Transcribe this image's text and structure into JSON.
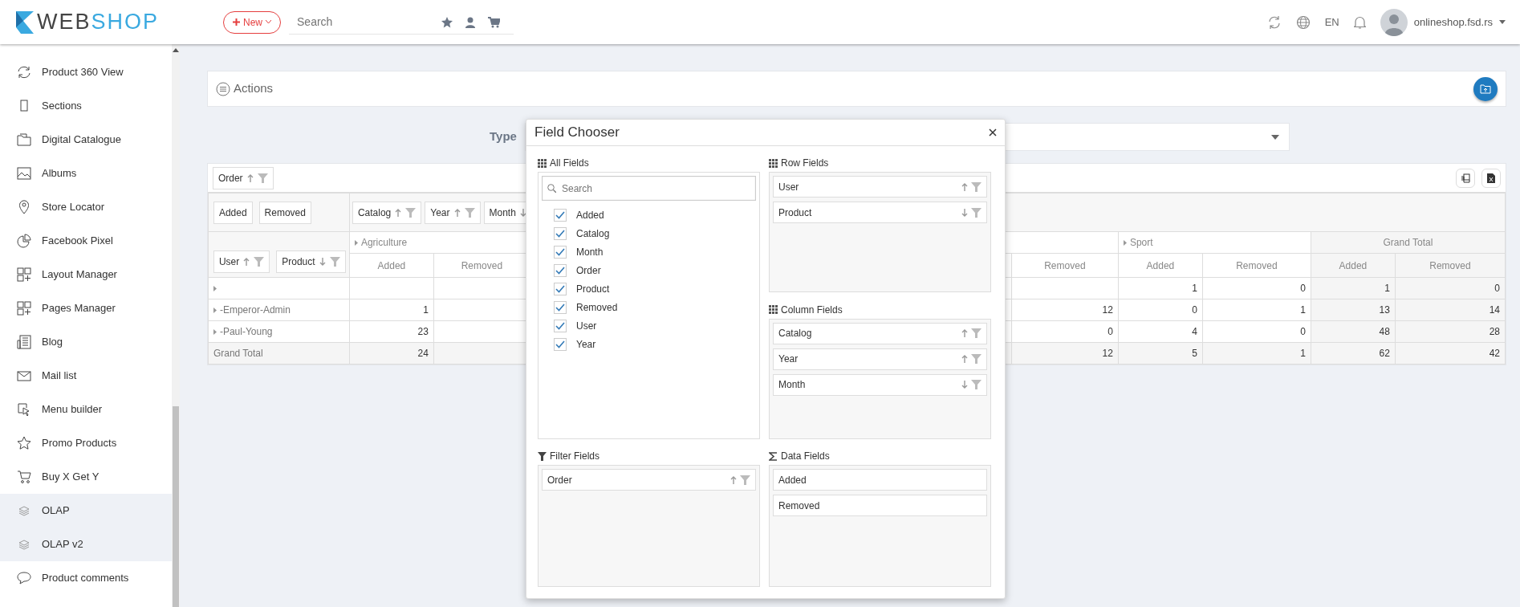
{
  "topbar": {
    "logo": {
      "dark": "WEB",
      "accent": "SHOP"
    },
    "new_button": "New",
    "search": {
      "placeholder": "Search"
    },
    "language": "EN",
    "account": "onlineshop.fsd.rs"
  },
  "sidebar": {
    "items": [
      {
        "label": "Product 360 View",
        "selected": false
      },
      {
        "label": "Sections",
        "selected": false
      },
      {
        "label": "Digital Catalogue",
        "selected": false
      },
      {
        "label": "Albums",
        "selected": false
      },
      {
        "label": "Store Locator",
        "selected": false
      },
      {
        "label": "Facebook Pixel",
        "selected": false
      },
      {
        "label": "Layout Manager",
        "selected": false
      },
      {
        "label": "Pages Manager",
        "selected": false
      },
      {
        "label": "Blog",
        "selected": false
      },
      {
        "label": "Mail list",
        "selected": false
      },
      {
        "label": "Menu builder",
        "selected": false
      },
      {
        "label": "Promo Products",
        "selected": false
      },
      {
        "label": "Buy X Get Y",
        "selected": false
      },
      {
        "label": "OLAP",
        "selected": true
      },
      {
        "label": "OLAP v2",
        "selected": true
      },
      {
        "label": "Product comments",
        "selected": false
      }
    ]
  },
  "actions": {
    "title": "Actions"
  },
  "type_filter": {
    "label": "Type"
  },
  "pivot": {
    "filter_fields": [
      {
        "label": "Order",
        "descending": false
      }
    ],
    "data_fields": [
      "Added",
      "Removed"
    ],
    "column_fields": [
      {
        "label": "Catalog",
        "descending": false
      },
      {
        "label": "Year",
        "descending": false
      },
      {
        "label": "Month",
        "descending": true
      }
    ],
    "row_fields": [
      {
        "label": "User",
        "descending": false
      },
      {
        "label": "Product",
        "descending": true
      }
    ],
    "column_groups": [
      {
        "label": "Agriculture",
        "expandable": true
      },
      {
        "label": "Sport",
        "expandable": true
      },
      {
        "label": "Grand Total",
        "expandable": false
      }
    ],
    "measure_headers": [
      "Added",
      "Removed",
      "Removed",
      "Added",
      "Removed",
      "Added",
      "Removed"
    ],
    "rows": [
      {
        "kind": "data",
        "expandable": true,
        "cells": [
          null,
          null,
          null,
          "1",
          "0",
          "1",
          "0"
        ]
      },
      {
        "kind": "data",
        "label": "-Emperor-Admin",
        "expandable": true,
        "cells": [
          "1",
          null,
          "12",
          "0",
          "1",
          "13",
          "14"
        ]
      },
      {
        "kind": "data",
        "label": "-Paul-Young",
        "expandable": true,
        "cells": [
          "23",
          null,
          "0",
          "4",
          "0",
          "48",
          "28"
        ]
      },
      {
        "kind": "total",
        "label": "Grand Total",
        "expandable": false,
        "cells": [
          "24",
          null,
          "12",
          "5",
          "1",
          "62",
          "42"
        ]
      }
    ]
  },
  "field_chooser": {
    "title": "Field Chooser",
    "all_fields": {
      "title": "All Fields",
      "search_placeholder": "Search",
      "items": [
        {
          "label": "Added",
          "checked": true
        },
        {
          "label": "Catalog",
          "checked": true
        },
        {
          "label": "Month",
          "checked": true
        },
        {
          "label": "Order",
          "checked": true
        },
        {
          "label": "Product",
          "checked": true
        },
        {
          "label": "Removed",
          "checked": true
        },
        {
          "label": "User",
          "checked": true
        },
        {
          "label": "Year",
          "checked": true
        }
      ]
    },
    "row_fields": {
      "title": "Row Fields",
      "items": [
        {
          "label": "User",
          "descending": false
        },
        {
          "label": "Product",
          "descending": true
        }
      ]
    },
    "column_fields": {
      "title": "Column Fields",
      "items": [
        {
          "label": "Catalog",
          "descending": false
        },
        {
          "label": "Year",
          "descending": false
        },
        {
          "label": "Month",
          "descending": true
        }
      ]
    },
    "filter_fields": {
      "title": "Filter Fields",
      "items": [
        {
          "label": "Order",
          "descending": false
        }
      ]
    },
    "data_fields": {
      "title": "Data Fields",
      "items": [
        {
          "label": "Added"
        },
        {
          "label": "Removed"
        }
      ]
    }
  }
}
